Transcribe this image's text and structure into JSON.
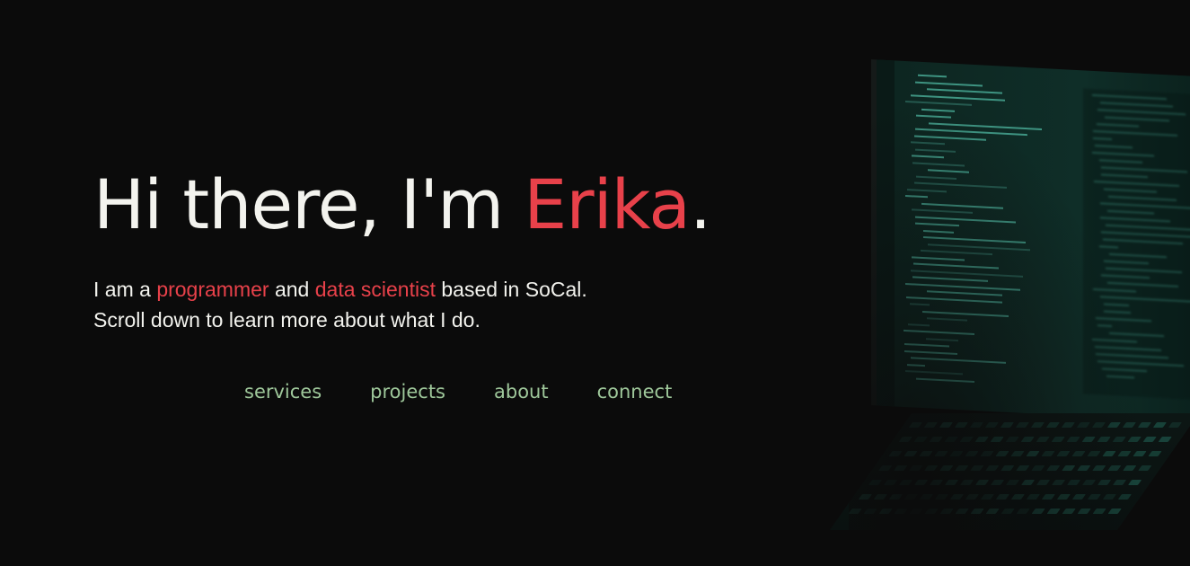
{
  "hero": {
    "greeting_prefix": "Hi there, I'm ",
    "name": "Erika",
    "greeting_suffix": ".",
    "intro": {
      "part1": "I am a ",
      "role1": "programmer",
      "part2": " and ",
      "role2": "data scientist",
      "part3": " based in SoCal.",
      "line2": "Scroll down to learn more about what I do."
    }
  },
  "nav": {
    "items": [
      {
        "label": "services"
      },
      {
        "label": "projects"
      },
      {
        "label": "about"
      },
      {
        "label": "connect"
      }
    ]
  },
  "background_image": {
    "icon": "laptop-with-code-editor"
  },
  "colors": {
    "background": "#0b0b0b",
    "text": "#f3f3ee",
    "accent": "#e8414a",
    "nav_link": "#9ec79a",
    "screen_code": "#4fb8a2"
  }
}
